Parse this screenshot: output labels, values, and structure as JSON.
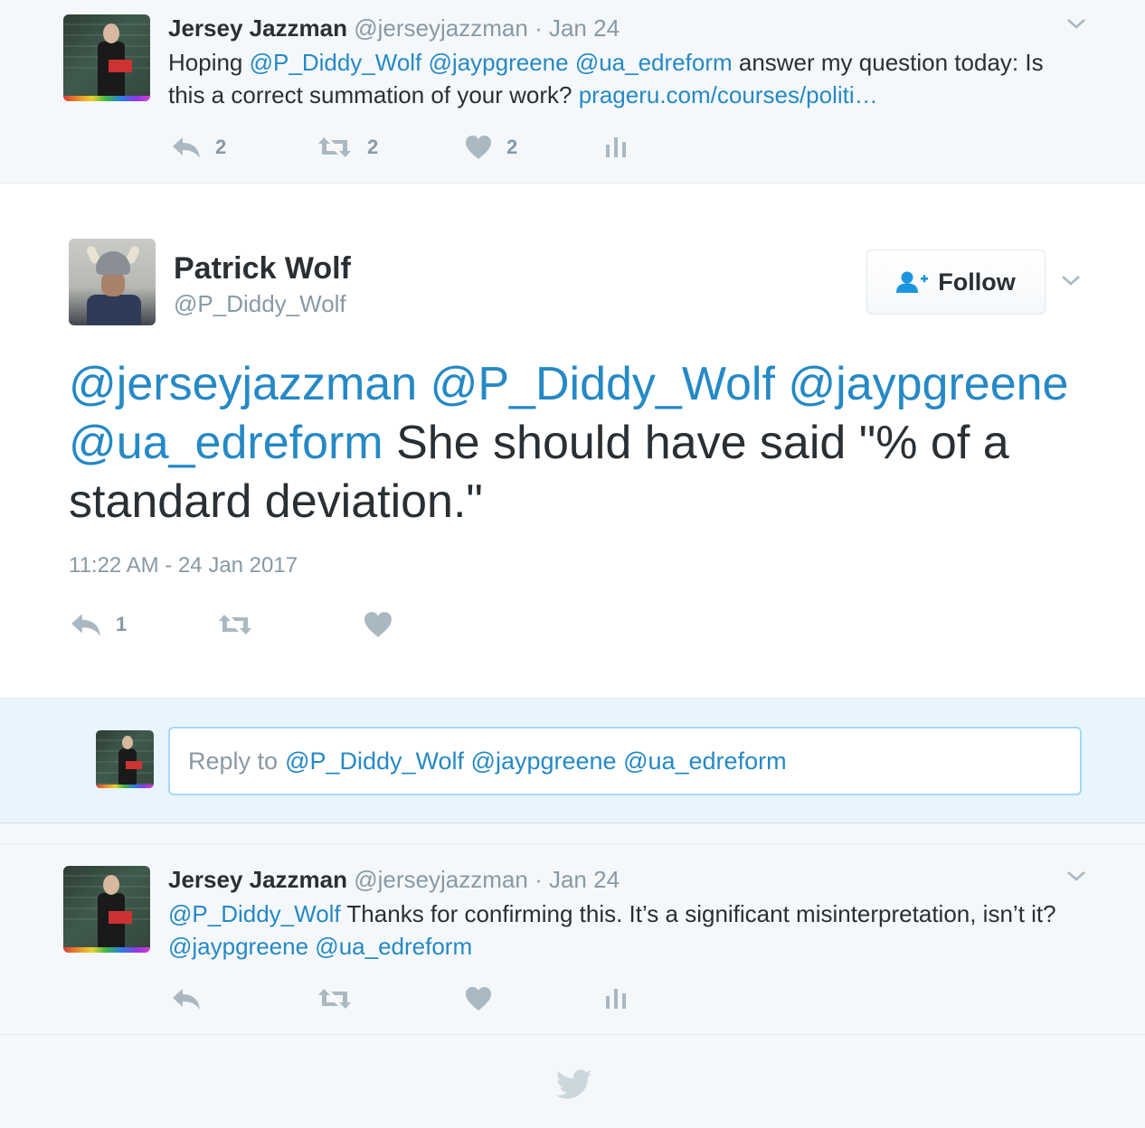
{
  "tweet1": {
    "author_name": "Jersey Jazzman",
    "author_handle": "@jerseyjazzman",
    "separator": "·",
    "date": "Jan 24",
    "text_parts": [
      "Hoping ",
      "@P_Diddy_Wolf",
      " ",
      "@jaypgreene",
      " ",
      "@ua_edreform",
      " answer my question today: Is this a correct summation of your work? ",
      "prageru.com/courses/politi…"
    ],
    "reply_count": "2",
    "retweet_count": "2",
    "like_count": "2"
  },
  "main": {
    "author_name": "Patrick Wolf",
    "author_handle": "@P_Diddy_Wolf",
    "follow_label": "Follow",
    "text_parts": [
      "@jerseyjazzman",
      " ",
      "@P_Diddy_Wolf",
      " ",
      "@jaypgreene",
      " ",
      "@ua_edreform",
      " She should have said \"% of a standard deviation.\""
    ],
    "timestamp": "11:22 AM - 24 Jan 2017",
    "reply_count": "1"
  },
  "reply_box": {
    "prefix": "Reply to",
    "mentions": "@P_Diddy_Wolf @jaypgreene @ua_edreform"
  },
  "tweet3": {
    "author_name": "Jersey Jazzman",
    "author_handle": "@jerseyjazzman",
    "separator": "·",
    "date": "Jan 24",
    "text_parts": [
      "@P_Diddy_Wolf",
      " Thanks for confirming this. It’s a significant misinterpretation, isn’t it? ",
      "@jaypgreene",
      " ",
      "@ua_edreform"
    ]
  },
  "colors": {
    "link": "#2589c5",
    "muted": "#8899a6",
    "reply_area_bg": "#e8f5fd"
  },
  "icons": [
    "reply-icon",
    "retweet-icon",
    "like-icon",
    "analytics-icon",
    "chevron-down-icon",
    "follow-person-icon",
    "twitter-bird-icon"
  ]
}
